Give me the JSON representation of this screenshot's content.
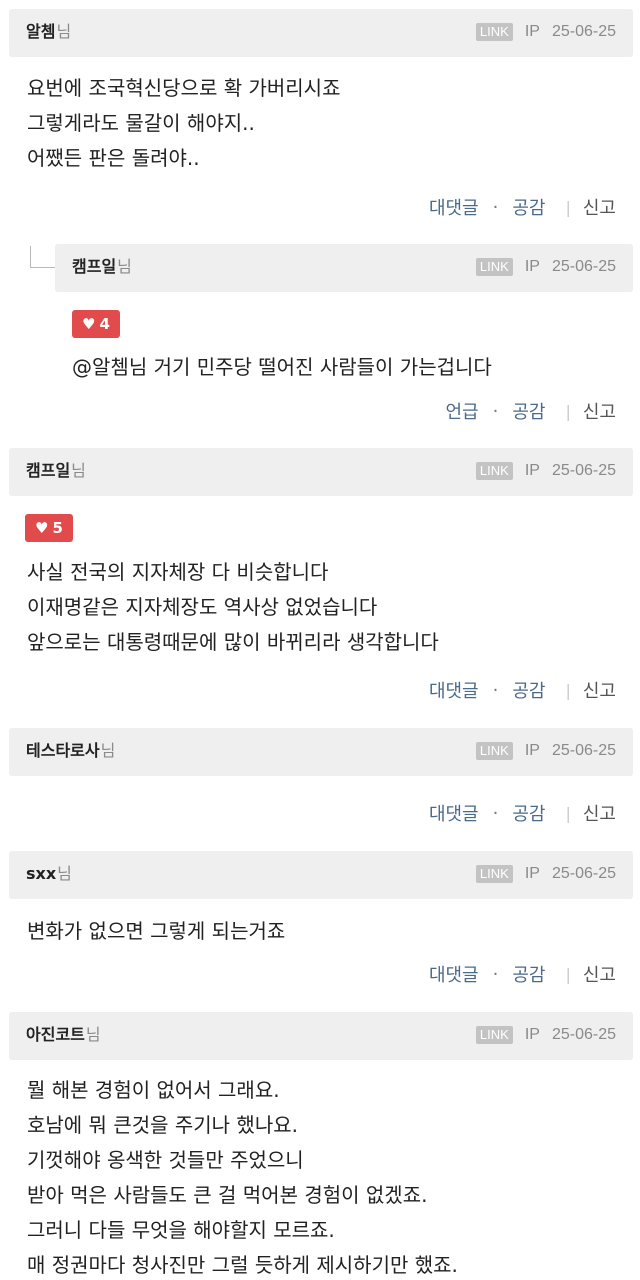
{
  "labels": {
    "nick_suffix": "님",
    "link_badge": "LINK",
    "ip": "IP",
    "reply": "대댓글",
    "mention": "언급",
    "sympathy": "공감",
    "report": "신고",
    "dot": "·"
  },
  "comments": [
    {
      "nick": "알쳄",
      "date": "25-06-25",
      "lines": [
        "요번에 조국혁신당으로 확 가버리시죠",
        "그렇게라도 물갈이 해야지..",
        "어쨌든 판은 돌려야.."
      ]
    },
    {
      "nick": "캠프일",
      "date": "25-06-25",
      "likes": "4",
      "mention": "@알쳄",
      "text": "님 거기 민주당 떨어진 사람들이 가는겁니다"
    },
    {
      "nick": "캠프일",
      "date": "25-06-25",
      "likes": "5",
      "lines": [
        "사실 전국의 지자체장 다 비슷합니다",
        "이재명같은 지자체장도 역사상 없었습니다",
        "앞으로는 대통령때문에 많이 바뀌리라 생각합니다"
      ]
    },
    {
      "nick": "테스타로사",
      "date": "25-06-25"
    },
    {
      "nick": "sxx",
      "date": "25-06-25",
      "lines": [
        "변화가 없으면 그렇게 되는거죠"
      ]
    },
    {
      "nick": "아진코트",
      "date": "25-06-25",
      "lines": [
        "뭘 해본 경험이 없어서 그래요.",
        "호남에 뭐 큰것을 주기나 했나요.",
        "기껏해야 옹색한 것들만 주었으니",
        "받아 먹은 사람들도 큰 걸 먹어본 경험이 없겠죠.",
        "그러니 다들 무엇을 해야할지 모르죠.",
        "매 정권마다 청사진만 그럴 듯하게 제시하기만 했죠."
      ]
    }
  ]
}
